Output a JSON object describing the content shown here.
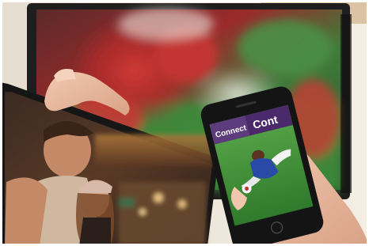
{
  "phone_screen": {
    "header_left": "Connect",
    "header_right": "Cont"
  },
  "palette": {
    "tv_bezel": "#2a2a2a",
    "field_green": "#3c8a3a",
    "jersey_red": "#b8302c",
    "tablet_bar": "#3a2f2a",
    "phone_header": "#4a2a6a",
    "wall": "#efe8dc"
  }
}
